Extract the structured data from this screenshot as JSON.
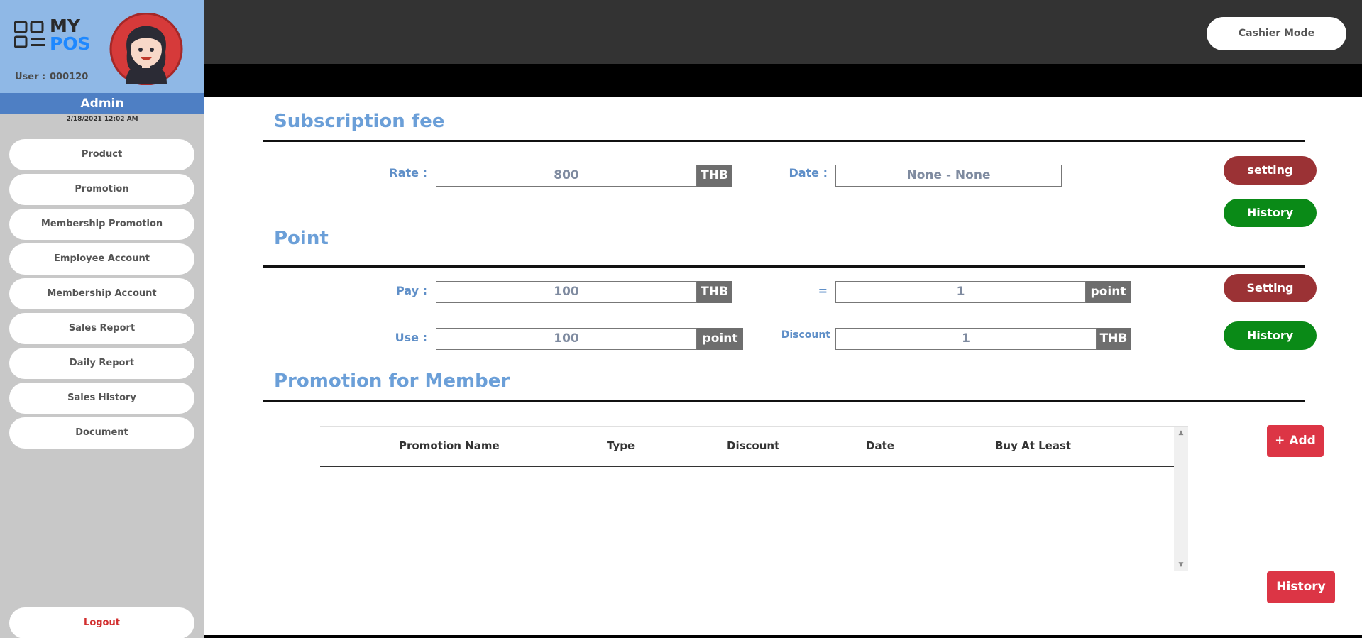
{
  "app": {
    "logo_line1": "MY",
    "logo_line2": "POS",
    "user_label": "User :",
    "user_id": "000120",
    "role": "Admin",
    "datetime": "2/18/2021 12:02 AM"
  },
  "sidebar": {
    "items": [
      {
        "label": "Product"
      },
      {
        "label": "Promotion"
      },
      {
        "label": "Membership Promotion"
      },
      {
        "label": "Employee Account"
      },
      {
        "label": "Membership Account"
      },
      {
        "label": "Sales Report"
      },
      {
        "label": "Daily Report"
      },
      {
        "label": "Sales History"
      },
      {
        "label": "Document"
      }
    ],
    "logout_label": "Logout"
  },
  "header": {
    "cashier_mode_label": "Cashier Mode"
  },
  "subscription": {
    "title": "Subscription fee",
    "rate_label": "Rate :",
    "rate_value": "800",
    "rate_unit": "THB",
    "date_label": "Date :",
    "date_value": "None - None",
    "setting_label": "setting",
    "history_label": "History"
  },
  "point": {
    "title": "Point",
    "pay_label": "Pay :",
    "pay_value": "100",
    "pay_unit": "THB",
    "equals_label": "=",
    "equals_value": "1",
    "equals_unit": "point",
    "use_label": "Use :",
    "use_value": "100",
    "use_unit": "point",
    "discount_label": "Discount",
    "discount_value": "1",
    "discount_unit": "THB",
    "setting_label": "Setting",
    "history_label": "History"
  },
  "promotion_member": {
    "title": "Promotion for Member",
    "columns": [
      "Promotion Name",
      "Type",
      "Discount",
      "Date",
      "Buy At Least"
    ],
    "rows": [],
    "add_label": "+ Add",
    "history_label": "History"
  },
  "colors": {
    "accent_blue": "#6b9fd8",
    "brand_blue": "#1e88ff",
    "danger_red": "#dc3545",
    "setting_red": "#9b3235",
    "history_green": "#0a8a17"
  }
}
